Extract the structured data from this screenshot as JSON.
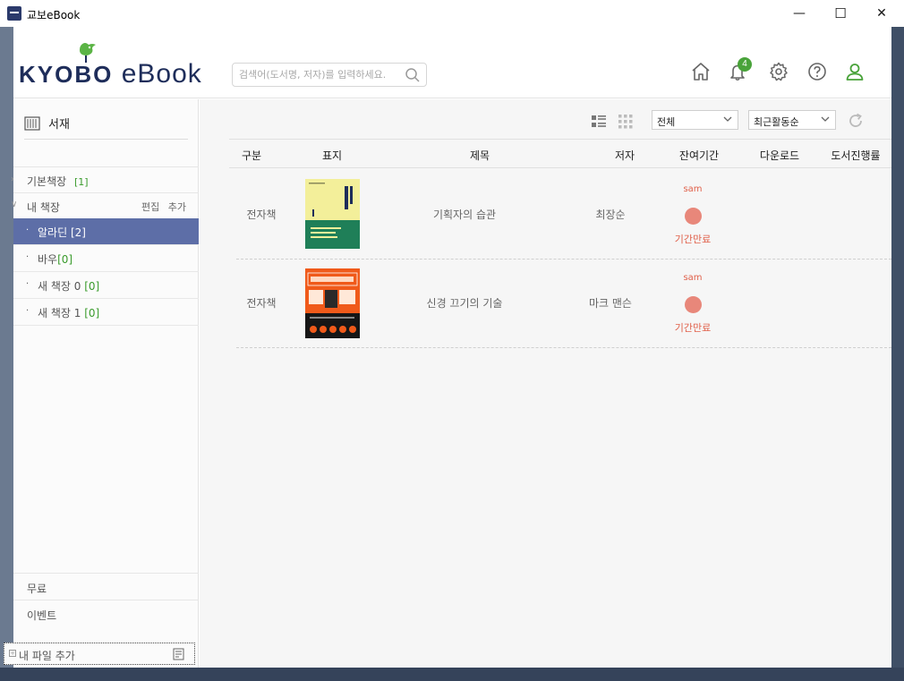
{
  "window": {
    "title": "교보eBook",
    "minimize": "—",
    "maximize": "☐",
    "close": "✕"
  },
  "header": {
    "logo_kyobo": "KYOBO",
    "logo_ebook": "eBook",
    "search_placeholder": "검색어(도서명, 저자)를 입력하세요.",
    "notification_count": "4",
    "icons": [
      "home-icon",
      "bell-icon",
      "gear-icon",
      "help-icon",
      "user-icon"
    ],
    "accent_color": "#49a33a"
  },
  "sidebar": {
    "title": "서재",
    "basic_shelf": {
      "label": "기본책장",
      "count": "[1]"
    },
    "my_shelf": {
      "label": "내 책장",
      "edit": "편집",
      "add": "추가"
    },
    "items": [
      {
        "label": "알라딘",
        "count": "[2]",
        "active": true
      },
      {
        "label": "바우",
        "count": "[0]",
        "active": false
      },
      {
        "label": "새 책장 0",
        "count": "[0]",
        "active": false
      },
      {
        "label": "새 책장 1",
        "count": "[0]",
        "active": false
      }
    ],
    "bottom": {
      "free": "무료",
      "event": "이벤트",
      "add_file": "내 파일 추가"
    }
  },
  "toolbar": {
    "filter_value": "전체",
    "sort_value": "최근활동순"
  },
  "table": {
    "columns": [
      "구분",
      "표지",
      "제목",
      "저자",
      "잔여기간",
      "다운로드",
      "도서진행률"
    ],
    "rows": [
      {
        "type": "전자책",
        "title": "기획자의 습관",
        "author": "최장순",
        "store": "sam",
        "status": "기간만료",
        "cover": "yellow-green"
      },
      {
        "type": "전자책",
        "title": "신경 끄기의 기술",
        "author": "마크 맨슨",
        "store": "sam",
        "status": "기간만료",
        "cover": "orange"
      }
    ]
  }
}
